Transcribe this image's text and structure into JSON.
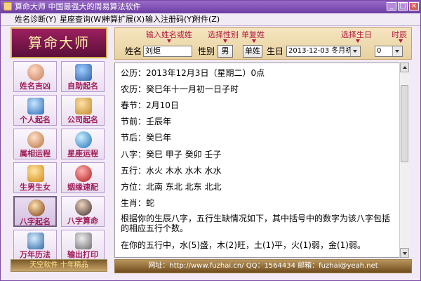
{
  "window": {
    "title": "算命大师  中国最强大的周易算法软件",
    "buttons": {
      "minimize": "_",
      "maximize": "□",
      "close": "×"
    }
  },
  "menu": {
    "items": [
      "姓名诊断(Y)",
      "星座查询(W)",
      "神算扩展(X)",
      "输入注册码(Y)",
      "附件(Z)"
    ]
  },
  "logo": {
    "text": "算命大师"
  },
  "left_panel": {
    "tiles": [
      {
        "label": "姓名吉凶",
        "icon": "face-icon"
      },
      {
        "label": "自助起名",
        "icon": "rocket-icon"
      },
      {
        "label": "个人起名",
        "icon": "person-card-icon"
      },
      {
        "label": "公司起名",
        "icon": "company-icon"
      },
      {
        "label": "属相运程",
        "icon": "cat-icon"
      },
      {
        "label": "星座运程",
        "icon": "globe-icon"
      },
      {
        "label": "生男生女",
        "icon": "baby-icon"
      },
      {
        "label": "姻缘速配",
        "icon": "knot-icon"
      },
      {
        "label": "八字起名",
        "icon": "bagua-icon",
        "active": true
      },
      {
        "label": "八字算命",
        "icon": "sage-icon"
      },
      {
        "label": "万年历法",
        "icon": "calendar-icon"
      },
      {
        "label": "输出打印",
        "icon": "printer-icon"
      }
    ],
    "footer": "天空软件 十年精品"
  },
  "input_panel": {
    "hints": {
      "name": "输入姓名或姓",
      "gender": "选择性别",
      "single_surname": "单复姓",
      "birthday": "选择生日",
      "hour": "时辰"
    },
    "labels": {
      "name": "姓名",
      "gender": "性别",
      "birthday": "生日"
    },
    "name_value": "刘炬",
    "gender_value": "男",
    "surname_type": "单姓",
    "birthday_value": "2013-12-03  冬月初一",
    "hour_value": "0"
  },
  "result": {
    "lines": [
      "公历：2013年12月3日（星期二）0点",
      "农历：癸巳年十一月初一日子时",
      "春节：2月10日",
      "节前：壬辰年",
      "节后：癸巳年",
      "八字：癸巳    甲子    癸卯    壬子",
      "五行：水火    木水    水木    水水",
      "方位：北南    东北    北东    北北",
      "生肖：蛇",
      "根据你的生辰八字，五行生缺情况如下，其中括号中的数字为该八字包括的相应五行个数。",
      "在你的五行中，水(5)盛，木(2)旺，土(1)平，火(1)弱，金(1)弱。"
    ]
  },
  "footer": {
    "text": "网址：http://www.fuzhai.cn/    QQ：1564434    邮箱：fuzhai@yeah.net"
  },
  "colors": {
    "title_bar": "#6b3ea3",
    "tile_label": "#a01b5a",
    "hint_text": "#b0173f",
    "logo_bg": "#9d1f5f"
  }
}
